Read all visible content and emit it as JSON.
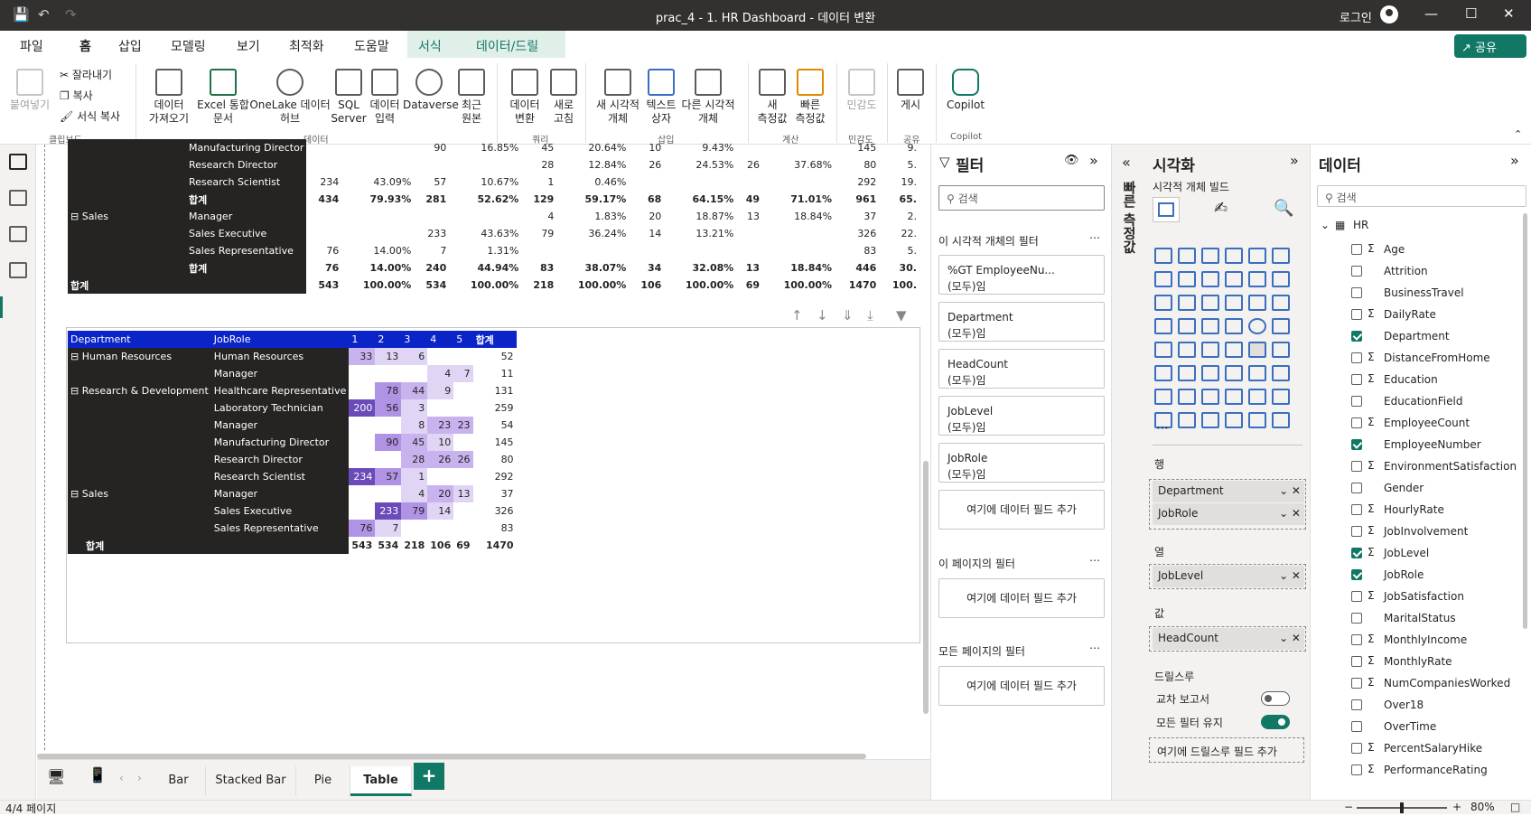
{
  "app": {
    "title": "prac_4 - 1. HR Dashboard - 데이터 변환",
    "login": "로그인"
  },
  "menu": [
    "파일",
    "홈",
    "삽입",
    "모델링",
    "보기",
    "최적화",
    "도움말",
    "서식",
    "데이터/드릴"
  ],
  "share": "공유",
  "ribbon": {
    "clipboard": {
      "paste": "붙여넣기",
      "cut": "잘라내기",
      "copy": "복사",
      "format": "서식 복사",
      "group": "클립보드"
    },
    "data_buttons": [
      "데이터\n가져오기",
      "Excel 통합\n문서",
      "OneLake 데이터\n허브",
      "SQL\nServer",
      "데이터\n입력",
      "Dataverse",
      "최근\n원본"
    ],
    "data_group": "데이터",
    "query_buttons": [
      "데이터\n변환",
      "새로\n고침"
    ],
    "query_group": "쿼리",
    "insert_buttons": [
      "새 시각적\n개체",
      "텍스트\n상자",
      "다른 시각적\n개체"
    ],
    "insert_group": "삽입",
    "calc_buttons": [
      "새\n측정값",
      "빠른\n측정값"
    ],
    "calc_group": "계산",
    "sens": "민감도",
    "sens_group": "민감도",
    "publish": "게시",
    "publish_group": "공유",
    "copilot": "Copilot",
    "copilot_group": "Copilot"
  },
  "top_table": {
    "rows": [
      [
        "",
        "Manufacturing Director",
        "",
        "",
        "90",
        "16.85%",
        "45",
        "20.64%",
        "10",
        "9.43%",
        "",
        "",
        "145",
        "9."
      ],
      [
        "",
        "Research Director",
        "",
        "",
        "",
        "",
        "28",
        "12.84%",
        "26",
        "24.53%",
        "26",
        "37.68%",
        "80",
        "5."
      ],
      [
        "",
        "Research Scientist",
        "234",
        "43.09%",
        "57",
        "10.67%",
        "1",
        "0.46%",
        "",
        "",
        "",
        "",
        "292",
        "19."
      ],
      [
        "",
        "합계",
        "434",
        "79.93%",
        "281",
        "52.62%",
        "129",
        "59.17%",
        "68",
        "64.15%",
        "49",
        "71.01%",
        "961",
        "65."
      ],
      [
        "Sales",
        "Manager",
        "",
        "",
        "",
        "",
        "4",
        "1.83%",
        "20",
        "18.87%",
        "13",
        "18.84%",
        "37",
        "2."
      ],
      [
        "",
        "Sales Executive",
        "",
        "",
        "233",
        "43.63%",
        "79",
        "36.24%",
        "14",
        "13.21%",
        "",
        "",
        "326",
        "22."
      ],
      [
        "",
        "Sales Representative",
        "76",
        "14.00%",
        "7",
        "1.31%",
        "",
        "",
        "",
        "",
        "",
        "",
        "83",
        "5."
      ],
      [
        "",
        "합계",
        "76",
        "14.00%",
        "240",
        "44.94%",
        "83",
        "38.07%",
        "34",
        "32.08%",
        "13",
        "18.84%",
        "446",
        "30."
      ],
      [
        "합계",
        "",
        "543",
        "100.00%",
        "534",
        "100.00%",
        "218",
        "100.00%",
        "106",
        "100.00%",
        "69",
        "100.00%",
        "1470",
        "100."
      ]
    ]
  },
  "matrix": {
    "headers": [
      "Department",
      "JobRole",
      "1",
      "2",
      "3",
      "4",
      "5",
      "합계"
    ],
    "rows": [
      {
        "dept": "Human Resources",
        "role": "Human Resources",
        "v": [
          "33",
          "13",
          "6",
          "",
          ""
        ],
        "t": "52",
        "lv": [
          2,
          1,
          1,
          0,
          0
        ]
      },
      {
        "dept": "",
        "role": "Manager",
        "v": [
          "",
          "",
          "",
          "4",
          "7"
        ],
        "t": "11",
        "lv": [
          0,
          0,
          0,
          1,
          1
        ]
      },
      {
        "dept": "Research & Development",
        "role": "Healthcare Representative",
        "v": [
          "",
          "78",
          "44",
          "9",
          ""
        ],
        "t": "131",
        "lv": [
          0,
          3,
          2,
          1,
          0
        ]
      },
      {
        "dept": "",
        "role": "Laboratory Technician",
        "v": [
          "200",
          "56",
          "3",
          "",
          ""
        ],
        "t": "259",
        "lv": [
          5,
          3,
          1,
          0,
          0
        ]
      },
      {
        "dept": "",
        "role": "Manager",
        "v": [
          "",
          "",
          "8",
          "23",
          "23"
        ],
        "t": "54",
        "lv": [
          0,
          0,
          1,
          2,
          2
        ]
      },
      {
        "dept": "",
        "role": "Manufacturing Director",
        "v": [
          "",
          "90",
          "45",
          "10",
          ""
        ],
        "t": "145",
        "lv": [
          0,
          3,
          2,
          1,
          0
        ]
      },
      {
        "dept": "",
        "role": "Research Director",
        "v": [
          "",
          "",
          "28",
          "26",
          "26"
        ],
        "t": "80",
        "lv": [
          0,
          0,
          2,
          2,
          2
        ]
      },
      {
        "dept": "",
        "role": "Research Scientist",
        "v": [
          "234",
          "57",
          "1",
          "",
          ""
        ],
        "t": "292",
        "lv": [
          5,
          3,
          1,
          0,
          0
        ]
      },
      {
        "dept": "Sales",
        "role": "Manager",
        "v": [
          "",
          "",
          "4",
          "20",
          "13"
        ],
        "t": "37",
        "lv": [
          0,
          0,
          1,
          2,
          1
        ]
      },
      {
        "dept": "",
        "role": "Sales Executive",
        "v": [
          "",
          "233",
          "79",
          "14",
          ""
        ],
        "t": "326",
        "lv": [
          0,
          5,
          3,
          1,
          0
        ]
      },
      {
        "dept": "",
        "role": "Sales Representative",
        "v": [
          "76",
          "7",
          "",
          "",
          ""
        ],
        "t": "83",
        "lv": [
          3,
          1,
          0,
          0,
          0
        ]
      }
    ],
    "total": {
      "label": "합계",
      "v": [
        "543",
        "534",
        "218",
        "106",
        "69"
      ],
      "t": "1470"
    }
  },
  "filters": {
    "title": "필터",
    "search": "검색",
    "visual_section": "이 시각적 개체의 필터",
    "cards": [
      [
        "%GT EmployeeNu...",
        "(모두)임"
      ],
      [
        "Department",
        "(모두)임"
      ],
      [
        "HeadCount",
        "(모두)임"
      ],
      [
        "JobLevel",
        "(모두)임"
      ],
      [
        "JobRole",
        "(모두)임"
      ]
    ],
    "add": "여기에 데이터 필드 추가",
    "page_section": "이 페이지의 필터",
    "all_section": "모든 페이지의 필터"
  },
  "quick_measure": "빠른 측정값",
  "viz": {
    "title": "시각화",
    "build": "시각적 개체 빌드",
    "rows_label": "행",
    "rows": [
      "Department",
      "JobRole"
    ],
    "cols_label": "열",
    "cols": [
      "JobLevel"
    ],
    "values_label": "값",
    "values": [
      "HeadCount"
    ],
    "drill": "드릴스루",
    "cross": "교차 보고서",
    "keep": "모든 필터 유지",
    "drill_add": "여기에 드릴스루 필드 추가",
    "toggle_off": "off",
    "toggle_on": "on"
  },
  "data": {
    "title": "데이터",
    "search": "검색",
    "table": "HR",
    "fields": [
      {
        "n": "Age",
        "s": true,
        "c": false
      },
      {
        "n": "Attrition",
        "s": false,
        "c": false
      },
      {
        "n": "BusinessTravel",
        "s": false,
        "c": false
      },
      {
        "n": "DailyRate",
        "s": true,
        "c": false
      },
      {
        "n": "Department",
        "s": false,
        "c": true
      },
      {
        "n": "DistanceFromHome",
        "s": true,
        "c": false
      },
      {
        "n": "Education",
        "s": true,
        "c": false
      },
      {
        "n": "EducationField",
        "s": false,
        "c": false
      },
      {
        "n": "EmployeeCount",
        "s": true,
        "c": false
      },
      {
        "n": "EmployeeNumber",
        "s": false,
        "c": true
      },
      {
        "n": "EnvironmentSatisfaction",
        "s": true,
        "c": false
      },
      {
        "n": "Gender",
        "s": false,
        "c": false
      },
      {
        "n": "HourlyRate",
        "s": true,
        "c": false
      },
      {
        "n": "JobInvolvement",
        "s": true,
        "c": false
      },
      {
        "n": "JobLevel",
        "s": true,
        "c": true
      },
      {
        "n": "JobRole",
        "s": false,
        "c": true
      },
      {
        "n": "JobSatisfaction",
        "s": true,
        "c": false
      },
      {
        "n": "MaritalStatus",
        "s": false,
        "c": false
      },
      {
        "n": "MonthlyIncome",
        "s": true,
        "c": false
      },
      {
        "n": "MonthlyRate",
        "s": true,
        "c": false
      },
      {
        "n": "NumCompaniesWorked",
        "s": true,
        "c": false
      },
      {
        "n": "Over18",
        "s": false,
        "c": false
      },
      {
        "n": "OverTime",
        "s": false,
        "c": false
      },
      {
        "n": "PercentSalaryHike",
        "s": true,
        "c": false
      },
      {
        "n": "PerformanceRating",
        "s": true,
        "c": false
      }
    ]
  },
  "tabs": [
    "Bar",
    "Stacked Bar",
    "Pie",
    "Table"
  ],
  "status": {
    "page": "4/4 페이지",
    "zoom": "80%"
  },
  "colors": {
    "accent": "#117865",
    "header_blue": "#0b24c8",
    "heat": [
      "#ffffff",
      "#e0d5f4",
      "#c9b3ee",
      "#b093e4",
      "#8a6ad1",
      "#6a4bb8"
    ]
  }
}
